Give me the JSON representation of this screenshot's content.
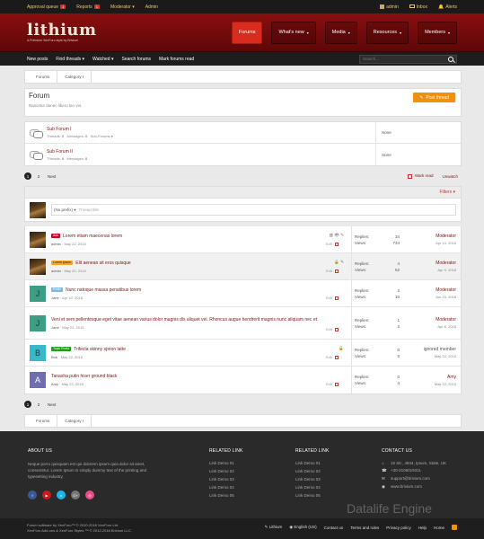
{
  "topbar": {
    "left": [
      {
        "label": "Approval queue",
        "badge": "1"
      },
      {
        "label": "Reports",
        "badge": "1"
      },
      {
        "label": "Moderator ▾",
        "badge": ""
      },
      {
        "label": "Admin",
        "badge": ""
      }
    ],
    "right": [
      {
        "label": "admin"
      },
      {
        "label": "Inbox"
      },
      {
        "label": "Alerts"
      }
    ]
  },
  "header": {
    "logo": "lithium",
    "tagline": "A Premium XenForo style by Brivium",
    "nav": [
      {
        "label": "Forums",
        "caret": "",
        "active": true
      },
      {
        "label": "What's new",
        "caret": "▾"
      },
      {
        "label": "Media",
        "caret": "▾"
      },
      {
        "label": "Resources",
        "caret": "▾"
      },
      {
        "label": "Members",
        "caret": "▾"
      }
    ]
  },
  "subnav": {
    "links": [
      "New posts",
      "Find threads ▾",
      "Watched ▾",
      "Search forums",
      "Mark forums read"
    ],
    "search_placeholder": "Search..."
  },
  "breadcrumb": [
    "Forums",
    "Category I"
  ],
  "forum": {
    "title": "Forum",
    "description": "Nascetur donec libero leo vel.",
    "post_thread": "Post thread"
  },
  "subforums": [
    {
      "title": "Sub Forum I",
      "threads_label": "Threads:",
      "threads": "0",
      "messages_label": "Messages:",
      "messages": "0",
      "extra": "Sub-Forums ▾",
      "last": "None"
    },
    {
      "title": "Sub Forum II",
      "threads_label": "Threads:",
      "threads": "0",
      "messages_label": "Messages:",
      "messages": "0",
      "extra": "",
      "last": "None"
    }
  ],
  "pager": {
    "pages": [
      "1",
      "2"
    ],
    "next": "Next",
    "mark_read": "Mark read",
    "unwatch": "Unwatch"
  },
  "filters": "Filters ▾",
  "new_thread": {
    "prefix": "(No prefix) ▾",
    "placeholder": "Thread title"
  },
  "threads": [
    {
      "prefix": "Ads",
      "prefix_color": "#d0021b",
      "title": "Lorem etiam maecenas lorem",
      "author": "admin",
      "date": "May 22, 2015",
      "icons": "▥ 👁 ✎",
      "edit": "Edit",
      "replies": "34",
      "views": "734",
      "last_user": "Moderator",
      "last_date": "Apr 14, 2018",
      "avatar": "",
      "avatar_color": ""
    },
    {
      "prefix": "Lorem ipsum",
      "prefix_color": "#f5a623",
      "title": "Elit aenean sit eros quisque",
      "author": "admin",
      "date": "May 22, 2015",
      "icons": "🔒 ✎",
      "edit": "Edit",
      "replies": "4",
      "views": "52",
      "last_user": "Moderator",
      "last_date": "Apr 9, 2018",
      "avatar": "",
      "avatar_color": ""
    },
    {
      "prefix": "Prefix",
      "prefix_color": "#7fb8e0",
      "title": "Nunc natoque massa penatibus lorem",
      "author": "Jane",
      "date": "Apr 10, 2018",
      "icons": "",
      "edit": "Edit",
      "replies": "2",
      "views": "10",
      "last_user": "Moderator",
      "last_date": "Jun 23, 2018",
      "avatar": "J",
      "avatar_color": "#3d9e86"
    },
    {
      "prefix": "",
      "prefix_color": "",
      "title": "Veni et sem pellentesque eget vitae aenean varius dolor magnis dis aliquet vel. Rhoncus augue hendrerit magnis nunc aliquam nec et",
      "author": "Jane",
      "date": "May 22, 2015",
      "icons": "",
      "edit": "Edit",
      "replies": "1",
      "views": "2",
      "last_user": "Moderator",
      "last_date": "Apr 6, 2018",
      "avatar": "J",
      "avatar_color": "#3d9e86"
    },
    {
      "prefix": "Topic Prefix",
      "prefix_color": "#1b9e1b",
      "title": "Trifecta skinny spoon latte",
      "author": "Bob",
      "date": "May 22, 2015",
      "icons": "🔒",
      "edit": "Edit",
      "replies": "0",
      "views": "6",
      "last_user": "ignored member",
      "last_date": "May 22, 2015",
      "avatar": "B",
      "avatar_color": "#39b8c9"
    },
    {
      "prefix": "",
      "prefix_color": "",
      "title": "Tanasha putin hiser ground black",
      "author": "Amy",
      "date": "May 22, 2015",
      "icons": "",
      "edit": "Edit",
      "replies": "0",
      "views": "4",
      "last_user": "Amy",
      "last_date": "May 22, 2015",
      "avatar": "A",
      "avatar_color": "#6f6fb0"
    }
  ],
  "stats_labels": {
    "replies": "Replies:",
    "views": "Views:"
  },
  "footer": {
    "about_h": "ABOUT US",
    "about_txt": "Neque porro quisquam est qui dolorem ipsum quia dolor sit amet, consectetur. Lorem Ipsum is simply dummy text of the printing and typesetting industry.",
    "related1_h": "RELATED LINK",
    "related1": [
      "Link Demo 01",
      "Link Demo 02",
      "Link Demo 03",
      "Link Demo 04",
      "Link Demo 05"
    ],
    "related2_h": "RELATED LINK",
    "related2": [
      "Link Demo 01",
      "Link Demo 02",
      "Link Demo 03",
      "Link Demo 04",
      "Link Demo 05"
    ],
    "contact_h": "CONTACT US",
    "contact": [
      {
        "icon": "⌂",
        "text": "15 Str., 4844, Ipsum, State, UK"
      },
      {
        "icon": "☎",
        "text": "+30-2106019311"
      },
      {
        "icon": "✉",
        "text": "support@brivium.com"
      },
      {
        "icon": "◉",
        "text": "www.brivium.com"
      }
    ],
    "social": [
      {
        "label": "f",
        "color": "#3b5998"
      },
      {
        "label": "▶",
        "color": "#cc181e"
      },
      {
        "label": "v",
        "color": "#1ab7ea"
      },
      {
        "label": "G+",
        "color": "#777"
      },
      {
        "label": "◎",
        "color": "#ea4c89"
      }
    ],
    "watermark": "Datalife Engine",
    "copy1": "Forum software by XenForo™ © 2010-2018 XenForo Ltd.",
    "copy2": "XenForo Add-ons & XenForo Styles ™ © 2012-2018 Brivium LLC.",
    "links": [
      "Lithium",
      "English (US)",
      "Contact us",
      "Terms and rules",
      "Privacy policy",
      "Help",
      "Home"
    ]
  }
}
